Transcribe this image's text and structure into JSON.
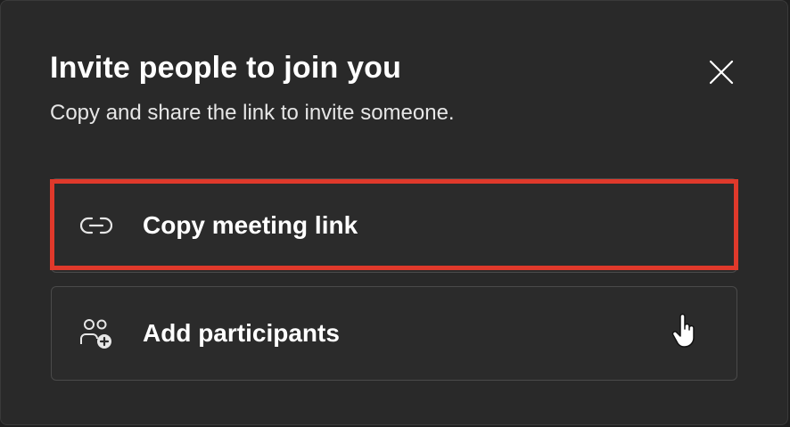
{
  "dialog": {
    "title": "Invite people to join you",
    "subtitle": "Copy and share the link to invite someone."
  },
  "options": [
    {
      "label": "Copy meeting link",
      "icon": "link-icon"
    },
    {
      "label": "Add participants",
      "icon": "add-people-icon"
    }
  ],
  "colors": {
    "background": "#292929",
    "highlight": "#e0392b",
    "text": "#ffffff"
  }
}
